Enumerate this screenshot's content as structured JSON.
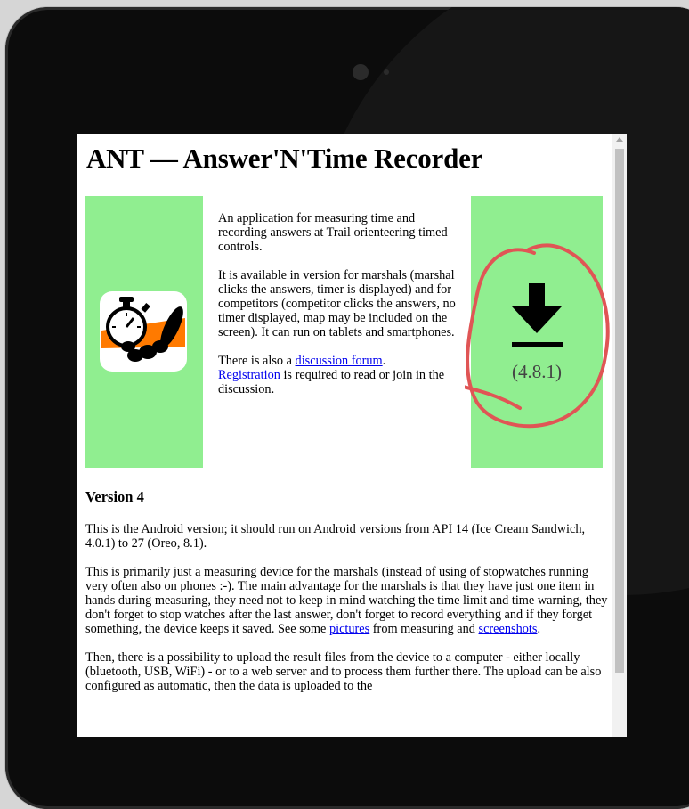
{
  "page": {
    "title": "ANT — Answer'N'Time Recorder",
    "intro": "An application for measuring time and recording answers at Trail orienteering timed controls.",
    "availability": "It is available in version for marshals (marshal clicks the answers, timer is displayed) and for competitors (competitor clicks the answers, no timer displayed, map may be included on the screen). It can run on tablets and smartphones.",
    "forum": {
      "prefix": "There is also a ",
      "forum_link": "discussion forum",
      "after_forum": ".",
      "registration_link": "Registration",
      "suffix": " is required to read or join in the discussion."
    },
    "download": {
      "version": "(4.8.1)",
      "icon": "download-icon"
    },
    "app_icon": "stopwatch-with-feather-icon",
    "version_heading": "Version 4",
    "para1": "This is the Android version; it should run on Android versions from API 14 (Ice Cream Sandwich, 4.0.1) to 27 (Oreo, 8.1).",
    "para2": {
      "text": "This is primarily just a measuring device for the marshals (instead of using of stopwatches running very often also on phones :-). The main advantage for the marshals is that they have just one item in hands during measuring, they need not to keep in mind watching the time limit and time warning, they don't forget to stop watches after the last answer, don't forget to record everything and if they forget something, the device keeps it saved. See some ",
      "pictures_link": "pictures",
      "middle": " from measuring and ",
      "screenshots_link": "screenshots",
      "end": "."
    },
    "para3": "Then, there is a possibility to upload the result files from the device to a computer - either locally (bluetooth, USB, WiFi) - or to a web server and to process them further there. The upload can be also configured as automatic, then the data is uploaded to the"
  },
  "colors": {
    "panel_green": "#90ee90",
    "link_blue": "#0000ee",
    "annotation_red": "#e05555",
    "bezel": "#0c0c0c"
  }
}
